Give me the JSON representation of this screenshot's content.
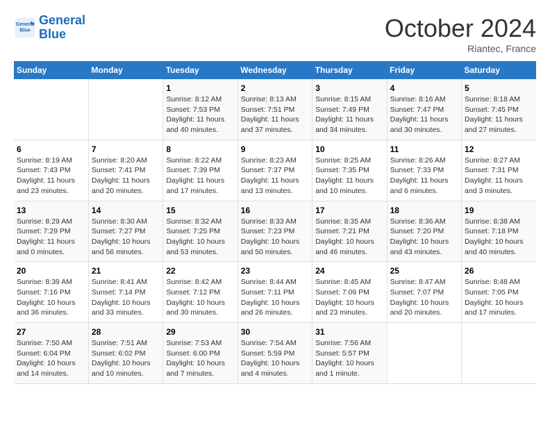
{
  "header": {
    "logo_line1": "General",
    "logo_line2": "Blue",
    "month": "October 2024",
    "location": "Riantec, France"
  },
  "weekdays": [
    "Sunday",
    "Monday",
    "Tuesday",
    "Wednesday",
    "Thursday",
    "Friday",
    "Saturday"
  ],
  "weeks": [
    [
      {
        "num": "",
        "info": ""
      },
      {
        "num": "",
        "info": ""
      },
      {
        "num": "1",
        "info": "Sunrise: 8:12 AM\nSunset: 7:53 PM\nDaylight: 11 hours and 40 minutes."
      },
      {
        "num": "2",
        "info": "Sunrise: 8:13 AM\nSunset: 7:51 PM\nDaylight: 11 hours and 37 minutes."
      },
      {
        "num": "3",
        "info": "Sunrise: 8:15 AM\nSunset: 7:49 PM\nDaylight: 11 hours and 34 minutes."
      },
      {
        "num": "4",
        "info": "Sunrise: 8:16 AM\nSunset: 7:47 PM\nDaylight: 11 hours and 30 minutes."
      },
      {
        "num": "5",
        "info": "Sunrise: 8:18 AM\nSunset: 7:45 PM\nDaylight: 11 hours and 27 minutes."
      }
    ],
    [
      {
        "num": "6",
        "info": "Sunrise: 8:19 AM\nSunset: 7:43 PM\nDaylight: 11 hours and 23 minutes."
      },
      {
        "num": "7",
        "info": "Sunrise: 8:20 AM\nSunset: 7:41 PM\nDaylight: 11 hours and 20 minutes."
      },
      {
        "num": "8",
        "info": "Sunrise: 8:22 AM\nSunset: 7:39 PM\nDaylight: 11 hours and 17 minutes."
      },
      {
        "num": "9",
        "info": "Sunrise: 8:23 AM\nSunset: 7:37 PM\nDaylight: 11 hours and 13 minutes."
      },
      {
        "num": "10",
        "info": "Sunrise: 8:25 AM\nSunset: 7:35 PM\nDaylight: 11 hours and 10 minutes."
      },
      {
        "num": "11",
        "info": "Sunrise: 8:26 AM\nSunset: 7:33 PM\nDaylight: 11 hours and 6 minutes."
      },
      {
        "num": "12",
        "info": "Sunrise: 8:27 AM\nSunset: 7:31 PM\nDaylight: 11 hours and 3 minutes."
      }
    ],
    [
      {
        "num": "13",
        "info": "Sunrise: 8:29 AM\nSunset: 7:29 PM\nDaylight: 11 hours and 0 minutes."
      },
      {
        "num": "14",
        "info": "Sunrise: 8:30 AM\nSunset: 7:27 PM\nDaylight: 10 hours and 56 minutes."
      },
      {
        "num": "15",
        "info": "Sunrise: 8:32 AM\nSunset: 7:25 PM\nDaylight: 10 hours and 53 minutes."
      },
      {
        "num": "16",
        "info": "Sunrise: 8:33 AM\nSunset: 7:23 PM\nDaylight: 10 hours and 50 minutes."
      },
      {
        "num": "17",
        "info": "Sunrise: 8:35 AM\nSunset: 7:21 PM\nDaylight: 10 hours and 46 minutes."
      },
      {
        "num": "18",
        "info": "Sunrise: 8:36 AM\nSunset: 7:20 PM\nDaylight: 10 hours and 43 minutes."
      },
      {
        "num": "19",
        "info": "Sunrise: 8:38 AM\nSunset: 7:18 PM\nDaylight: 10 hours and 40 minutes."
      }
    ],
    [
      {
        "num": "20",
        "info": "Sunrise: 8:39 AM\nSunset: 7:16 PM\nDaylight: 10 hours and 36 minutes."
      },
      {
        "num": "21",
        "info": "Sunrise: 8:41 AM\nSunset: 7:14 PM\nDaylight: 10 hours and 33 minutes."
      },
      {
        "num": "22",
        "info": "Sunrise: 8:42 AM\nSunset: 7:12 PM\nDaylight: 10 hours and 30 minutes."
      },
      {
        "num": "23",
        "info": "Sunrise: 8:44 AM\nSunset: 7:11 PM\nDaylight: 10 hours and 26 minutes."
      },
      {
        "num": "24",
        "info": "Sunrise: 8:45 AM\nSunset: 7:09 PM\nDaylight: 10 hours and 23 minutes."
      },
      {
        "num": "25",
        "info": "Sunrise: 8:47 AM\nSunset: 7:07 PM\nDaylight: 10 hours and 20 minutes."
      },
      {
        "num": "26",
        "info": "Sunrise: 8:48 AM\nSunset: 7:05 PM\nDaylight: 10 hours and 17 minutes."
      }
    ],
    [
      {
        "num": "27",
        "info": "Sunrise: 7:50 AM\nSunset: 6:04 PM\nDaylight: 10 hours and 14 minutes."
      },
      {
        "num": "28",
        "info": "Sunrise: 7:51 AM\nSunset: 6:02 PM\nDaylight: 10 hours and 10 minutes."
      },
      {
        "num": "29",
        "info": "Sunrise: 7:53 AM\nSunset: 6:00 PM\nDaylight: 10 hours and 7 minutes."
      },
      {
        "num": "30",
        "info": "Sunrise: 7:54 AM\nSunset: 5:59 PM\nDaylight: 10 hours and 4 minutes."
      },
      {
        "num": "31",
        "info": "Sunrise: 7:56 AM\nSunset: 5:57 PM\nDaylight: 10 hours and 1 minute."
      },
      {
        "num": "",
        "info": ""
      },
      {
        "num": "",
        "info": ""
      }
    ]
  ]
}
